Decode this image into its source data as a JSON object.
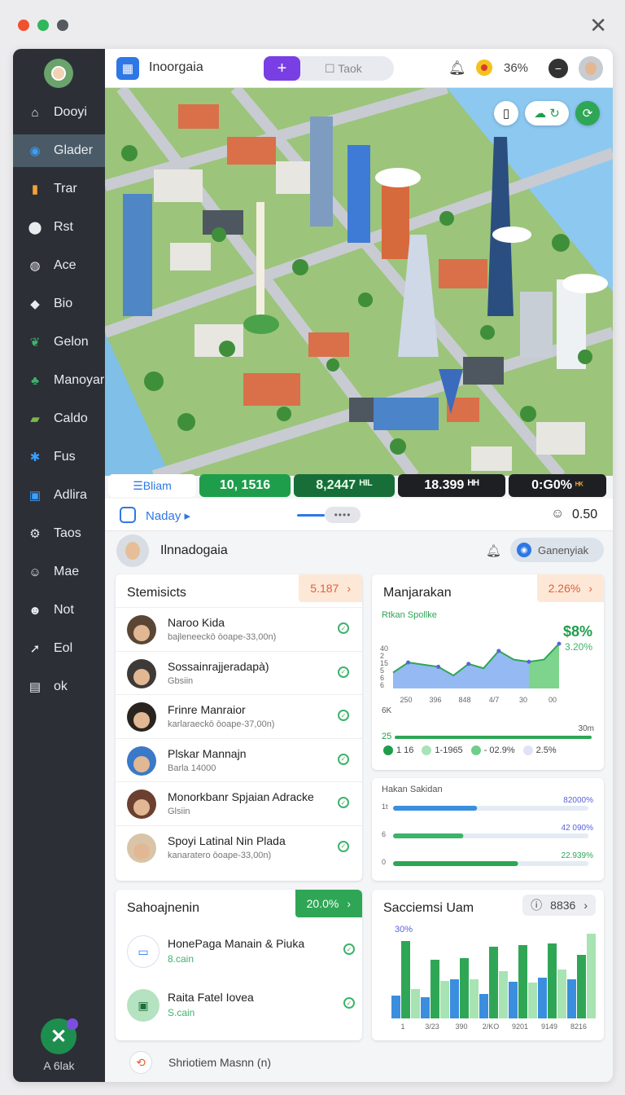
{
  "window": {
    "traffic_colors": [
      "#f0522f",
      "#2fb75a",
      "#555a60"
    ],
    "close_glyph": "✕"
  },
  "sidebar": {
    "items": [
      {
        "label": "Dooyi",
        "icon": "home-icon",
        "glyph": "⌂",
        "color": "#e9ecef"
      },
      {
        "label": "Glader",
        "icon": "search-icon",
        "glyph": "◉",
        "color": "#3aa0ff",
        "active": true
      },
      {
        "label": "Trar",
        "icon": "traffic-light-icon",
        "glyph": "▮",
        "color": "#f2a33a"
      },
      {
        "label": "Rst",
        "icon": "location-pin-icon",
        "glyph": "⬤",
        "color": "#e9ecef"
      },
      {
        "label": "Ace",
        "icon": "shield-icon",
        "glyph": "◍",
        "color": "#e9ecef"
      },
      {
        "label": "Bio",
        "icon": "drop-icon",
        "glyph": "◆",
        "color": "#e9ecef"
      },
      {
        "label": "Gelon",
        "icon": "leaf-icon",
        "glyph": "❦",
        "color": "#3db36b"
      },
      {
        "label": "Manoyar",
        "icon": "sprout-icon",
        "glyph": "♣",
        "color": "#3db36b"
      },
      {
        "label": "Caldo",
        "icon": "folder-icon",
        "glyph": "▰",
        "color": "#7fb84a"
      },
      {
        "label": "Fus",
        "icon": "star-icon",
        "glyph": "✱",
        "color": "#3aa0ff"
      },
      {
        "label": "Adlira",
        "icon": "image-icon",
        "glyph": "▣",
        "color": "#3aa0ff"
      },
      {
        "label": "Taos",
        "icon": "gear-icon",
        "glyph": "⚙",
        "color": "#e9ecef"
      },
      {
        "label": "Mae",
        "icon": "user-icon",
        "glyph": "☺",
        "color": "#e9ecef"
      },
      {
        "label": "Not",
        "icon": "users-icon",
        "glyph": "☻",
        "color": "#e9ecef"
      },
      {
        "label": "Eol",
        "icon": "pin-icon",
        "glyph": "➚",
        "color": "#e9ecef"
      },
      {
        "label": "ok",
        "icon": "document-icon",
        "glyph": "▤",
        "color": "#e9ecef"
      }
    ],
    "fab_glyph": "✕",
    "footer_label": "A 6lak"
  },
  "topbar": {
    "app_title": "Inoorgaia",
    "plus_glyph": "+",
    "tab_label": "Taok",
    "percent": "36%",
    "minus_glyph": "−"
  },
  "map": {
    "controls": [
      "▯",
      "☁ ↻",
      "⟳"
    ]
  },
  "stats": {
    "tab_label": "Bliam",
    "values": [
      "10, 1516",
      "8,2447 ᴴᴵᴸ",
      "18.399 ᴴᴴ",
      "0:G0%"
    ],
    "last_suffix": "ᴴᴷ"
  },
  "subbar": {
    "nav_label": "Naday ▸",
    "dots": "••••",
    "user_value": "0.50"
  },
  "header2": {
    "title": "Ilnnadogaia",
    "pill_label": "Ganenyiak"
  },
  "people_card": {
    "title": "Stemisicts",
    "badge": "5.187",
    "people": [
      {
        "name": "Naroo Kida",
        "sub": "bajleneeckō ōoape-33,00n)"
      },
      {
        "name": "Sossainrajjeradapà)",
        "sub": "Gbsiin"
      },
      {
        "name": "Frinre Manraior",
        "sub": "karlaraeckō ōoape-37,00n)"
      },
      {
        "name": "Plskar Mannajn",
        "sub": "Barla 14000"
      },
      {
        "name": "Monorkbanr Spjaian Adracke",
        "sub": "Glsiin"
      },
      {
        "name": "Spoyi Latinal Nin Plada",
        "sub": "kanaratero ōoape-33,00n)"
      }
    ]
  },
  "chart_card": {
    "title": "Manjarakan",
    "badge": "2.26%"
  },
  "chart_data": [
    {
      "type": "area",
      "series_label": "Rtkan Spollke",
      "x": [
        "250",
        "396",
        "848",
        "4/7",
        "30",
        "00"
      ],
      "series": [
        {
          "values": [
            22,
            36,
            33,
            30,
            18,
            34,
            28,
            52,
            40,
            37,
            40,
            62
          ],
          "color": "#7aa9f0"
        }
      ],
      "y_ticks": [
        "40",
        "2",
        "15",
        "5",
        "6",
        "6"
      ],
      "headline_value": "$8%",
      "headline_sub": "3.20%",
      "axis_note_left": "6K",
      "axis_note_right": "30m",
      "left_bottom": "25",
      "legend": [
        {
          "label": "1 16",
          "color": "#1e9e4b"
        },
        {
          "label": "1-1965",
          "color": "#a9e2b8"
        },
        {
          "label": "- 02.9%",
          "color": "#6fcf8a"
        },
        {
          "label": "2.5%",
          "color": "#dfe3f5"
        }
      ]
    },
    {
      "type": "bar",
      "title": "Hakan Sakidan",
      "categories": [
        "1t",
        "6",
        "0"
      ],
      "values": [
        82,
        42,
        22
      ],
      "labels": [
        "82000%",
        "42 090%",
        "22.939%"
      ],
      "colors": [
        "#3b8ddd",
        "#3db36b",
        "#2ea655"
      ]
    },
    {
      "type": "bar",
      "title": "Sacciemsi Uam",
      "badge": "8836",
      "peak_label": "30%",
      "categories": [
        "1",
        "3/23",
        "390",
        "2/KO",
        "9201",
        "9149",
        "8216"
      ],
      "series": [
        {
          "values": [
            28,
            26,
            48,
            30,
            45,
            50,
            48
          ],
          "color": "#3b8ddd"
        },
        {
          "values": [
            95,
            72,
            74,
            88,
            90,
            92,
            78
          ],
          "color": "#2ea655"
        },
        {
          "values": [
            36,
            46,
            48,
            58,
            44,
            60,
            104
          ],
          "color": "#a8e3b4"
        }
      ]
    }
  ],
  "tasks_card": {
    "title": "Sahoajnenin",
    "badge": "20.0%",
    "tasks": [
      {
        "name": "HonePaga Manain & Piuka",
        "sub": "8.cain",
        "icon": "card-icon"
      },
      {
        "name": "Raita Fatel Iovea",
        "sub": "S.cain",
        "icon": "briefcase-icon"
      }
    ]
  },
  "footer": {
    "label": "Shriotiem Masnn  (n)"
  }
}
